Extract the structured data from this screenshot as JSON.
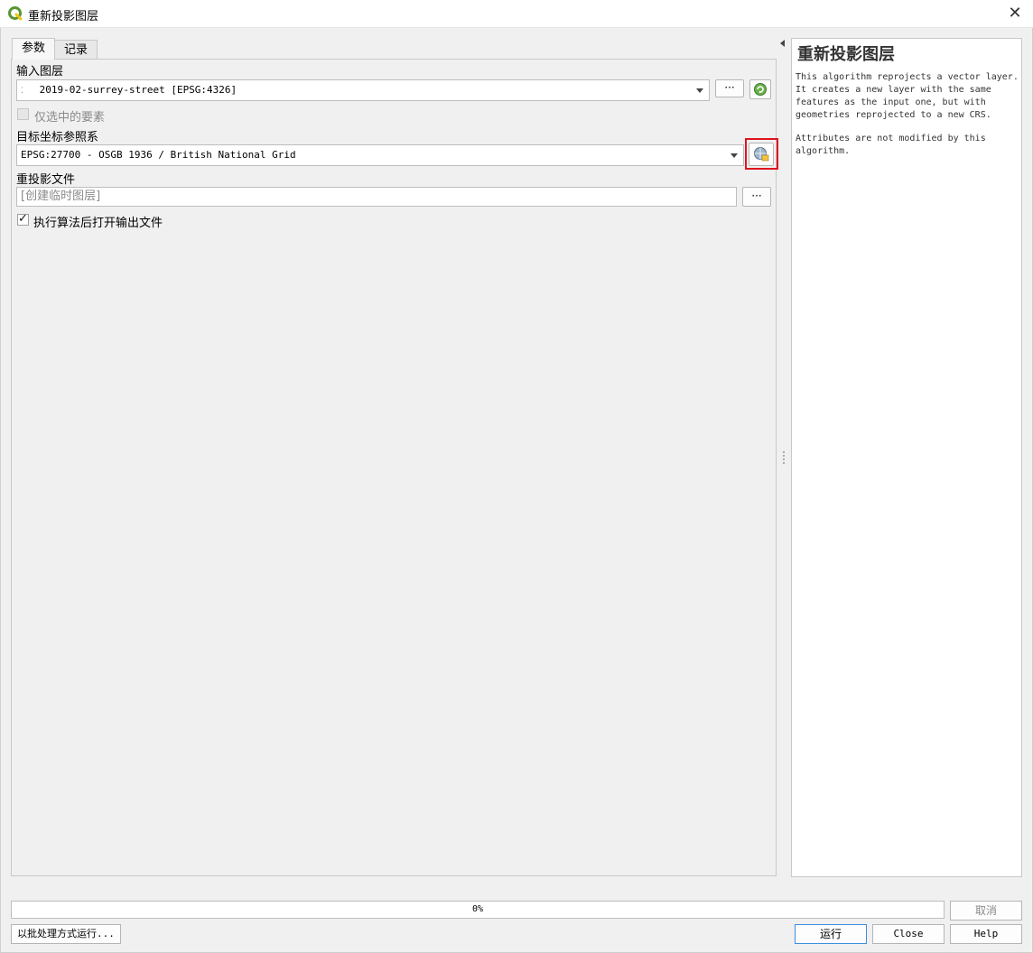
{
  "window": {
    "title": "重新投影图层",
    "close_glyph": "✕"
  },
  "tabs": [
    {
      "label": "参数",
      "active": true
    },
    {
      "label": "记录",
      "active": false
    }
  ],
  "params": {
    "input_layer_label": "输入图层",
    "input_layer_value": "2019-02-surrey-street [EPSG:4326]",
    "browse_button": "···",
    "selected_only_label": "仅选中的要素",
    "target_crs_label": "目标坐标参照系",
    "target_crs_value": "EPSG:27700 - OSGB 1936 / British National Grid",
    "reprojected_label": "重投影文件",
    "reprojected_placeholder": "[创建临时图层]",
    "open_output_label": "执行算法后打开输出文件"
  },
  "help": {
    "title": "重新投影图层",
    "paragraph1": "This algorithm reprojects a vector layer. It creates a new layer with the same features as the input one, but with geometries reprojected to a new CRS.",
    "paragraph2": "Attributes are not modified by this algorithm."
  },
  "footer": {
    "progress_text": "0%",
    "cancel_button": "取消",
    "batch_button": "以批处理方式运行...",
    "run_button": "运行",
    "close_button": "Close",
    "help_button": "Help"
  },
  "colors": {
    "highlight": "#e0141e",
    "qgis_green": "#589632"
  }
}
